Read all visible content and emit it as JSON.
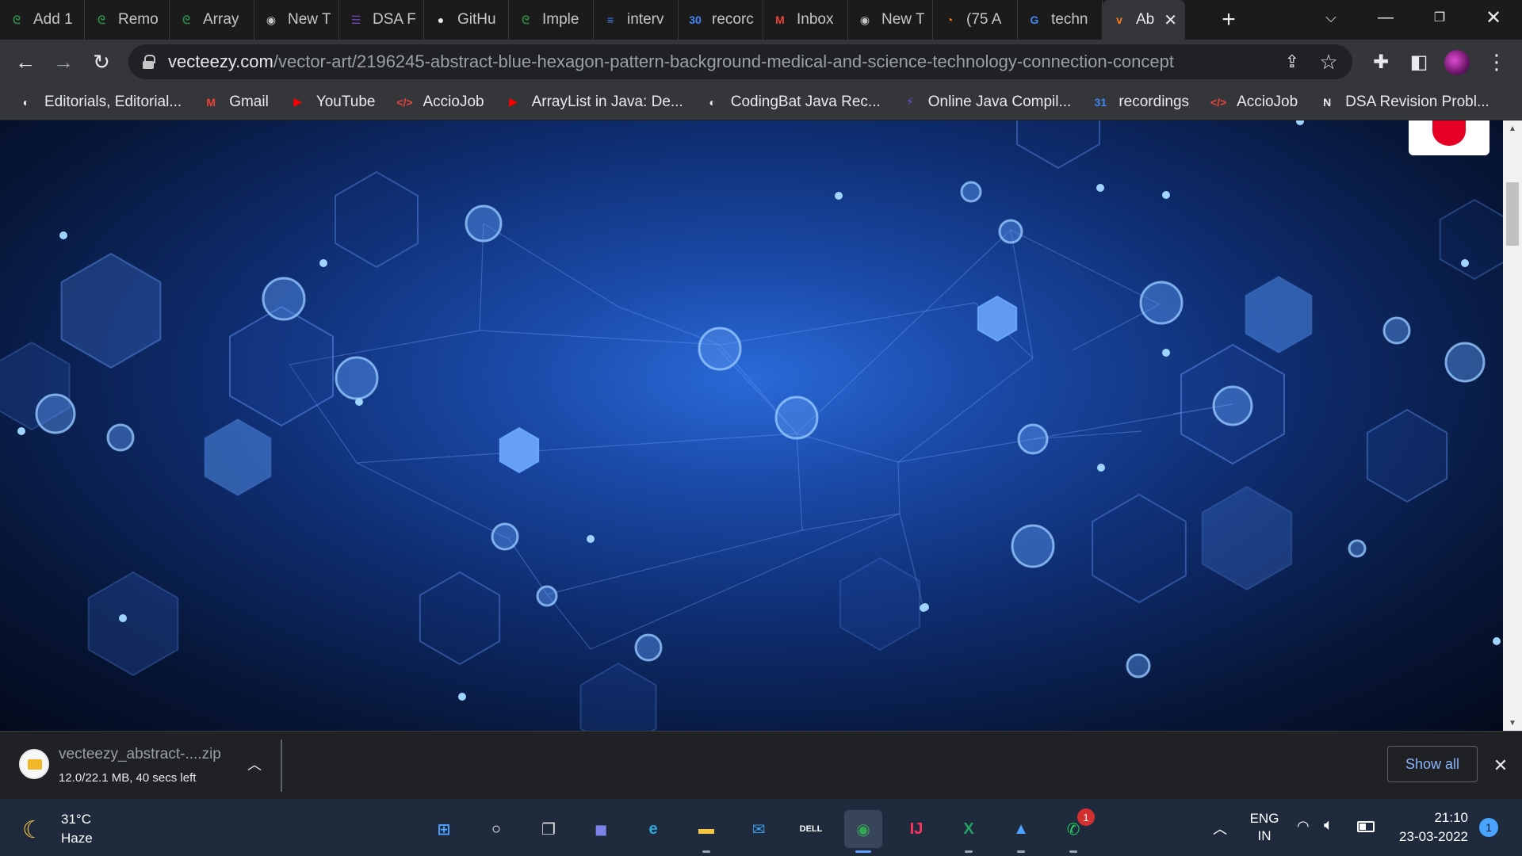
{
  "browser": {
    "tabs": [
      {
        "title": "Add 1",
        "icon": "gfg-icon",
        "color": "#2f8d46",
        "glyph": "ᘓ"
      },
      {
        "title": "Remo",
        "icon": "gfg-icon",
        "color": "#2f8d46",
        "glyph": "ᘓ"
      },
      {
        "title": "Array",
        "icon": "gfg-icon",
        "color": "#2f8d46",
        "glyph": "ᘓ"
      },
      {
        "title": "New T",
        "icon": "chrome-newtab-icon",
        "color": "#c4c7c5",
        "glyph": "◉"
      },
      {
        "title": "DSA F",
        "icon": "list-doc-icon",
        "color": "#7248b9",
        "glyph": "☰"
      },
      {
        "title": "GitHu",
        "icon": "github-icon",
        "color": "#e8eaed",
        "glyph": "●"
      },
      {
        "title": "Imple",
        "icon": "gfg-icon",
        "color": "#2f8d46",
        "glyph": "ᘓ"
      },
      {
        "title": "interv",
        "icon": "google-docs-icon",
        "color": "#4285f4",
        "glyph": "≡"
      },
      {
        "title": "recorc",
        "icon": "calendar-icon",
        "color": "#4285f4",
        "glyph": "30"
      },
      {
        "title": "Inbox",
        "icon": "gmail-icon",
        "color": "#ea4335",
        "glyph": "M"
      },
      {
        "title": "New T",
        "icon": "chrome-newtab-icon",
        "color": "#c4c7c5",
        "glyph": "◉"
      },
      {
        "title": "(75 A",
        "icon": "media-icon",
        "color": "#ff7a1a",
        "glyph": "◔"
      },
      {
        "title": "techn",
        "icon": "google-icon",
        "color": "#4285f4",
        "glyph": "G"
      },
      {
        "title": "Ab",
        "icon": "vecteezy-icon",
        "color": "#ff7a1a",
        "glyph": "v"
      }
    ],
    "active_tab_index": 13,
    "url_host": "vecteezy.com",
    "url_path": "/vector-art/2196245-abstract-blue-hexagon-pattern-background-medical-and-science-technology-connection-concept",
    "bookmarks": [
      {
        "label": "Editorials, Editorial...",
        "icon": "globe-icon",
        "color": "#e8eaed",
        "glyph": "◐"
      },
      {
        "label": "Gmail",
        "icon": "gmail-icon",
        "color": "#ea4335",
        "glyph": "M"
      },
      {
        "label": "YouTube",
        "icon": "youtube-icon",
        "color": "#ff0000",
        "glyph": "▶"
      },
      {
        "label": "AccioJob",
        "icon": "code-icon",
        "color": "#e8453c",
        "glyph": "</>"
      },
      {
        "label": "ArrayList in Java: De...",
        "icon": "youtube-icon",
        "color": "#ff0000",
        "glyph": "▶"
      },
      {
        "label": "CodingBat Java Rec...",
        "icon": "globe-icon",
        "color": "#e8eaed",
        "glyph": "◐"
      },
      {
        "label": "Online Java Compil...",
        "icon": "bolt-icon",
        "color": "#6a4fd8",
        "glyph": "⚡"
      },
      {
        "label": "recordings",
        "icon": "calendar-icon",
        "color": "#4285f4",
        "glyph": "31"
      },
      {
        "label": "AccioJob",
        "icon": "code-icon",
        "color": "#e8453c",
        "glyph": "</>"
      },
      {
        "label": "DSA Revision Probl...",
        "icon": "notion-icon",
        "color": "#e8eaed",
        "glyph": "N"
      }
    ]
  },
  "downloads": {
    "file_name": "vecteezy_abstract-....zip",
    "status": "12.0/22.1 MB, 40 secs left",
    "show_all": "Show all"
  },
  "taskbar": {
    "weather_temp": "31°C",
    "weather_desc": "Haze",
    "apps": [
      {
        "name": "start-button",
        "glyph": "⊞",
        "color": "#4aa3ff",
        "running": false
      },
      {
        "name": "search-button",
        "glyph": "○",
        "color": "#ffffff",
        "running": false
      },
      {
        "name": "task-view-button",
        "glyph": "❐",
        "color": "#dddddd",
        "running": false
      },
      {
        "name": "teams-chat-button",
        "glyph": "◼",
        "color": "#7b83eb",
        "running": false
      },
      {
        "name": "edge-app",
        "glyph": "e",
        "color": "#2aa8d8",
        "running": false
      },
      {
        "name": "file-explorer-app",
        "glyph": "▬",
        "color": "#f5c542",
        "running": true
      },
      {
        "name": "mail-app",
        "glyph": "✉",
        "color": "#3a96dd",
        "running": false
      },
      {
        "name": "dell-app",
        "glyph": "DELL",
        "color": "#ffffff",
        "running": false
      },
      {
        "name": "chrome-app",
        "glyph": "◉",
        "color": "#34a853",
        "running": true,
        "active": true
      },
      {
        "name": "intellij-app",
        "glyph": "IJ",
        "color": "#fe315d",
        "running": false
      },
      {
        "name": "excel-app",
        "glyph": "X",
        "color": "#21a366",
        "running": true
      },
      {
        "name": "photos-app",
        "glyph": "▲",
        "color": "#4aa3ff",
        "running": true
      },
      {
        "name": "whatsapp-app",
        "glyph": "✆",
        "color": "#25d366",
        "running": true
      }
    ],
    "whatsapp_badge": "1",
    "lang_line1": "ENG",
    "lang_line2": "IN",
    "time": "21:10",
    "date": "23-03-2022",
    "notifications": "1"
  }
}
